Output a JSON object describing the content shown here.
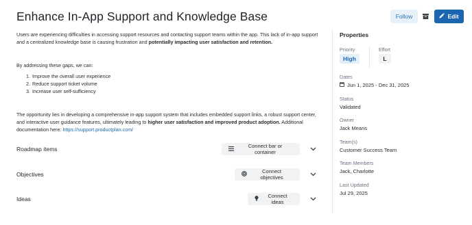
{
  "header": {
    "title": "Enhance In-App Support and Knowledge Base",
    "follow_label": "Follow",
    "edit_label": "Edit"
  },
  "description": {
    "p1_start": "Users are experiencing difficulties in accessing support resources and contacting support teams within the app. This lack of in-app support and a centralized knowledge base is causing frustration and ",
    "p1_bold": "potentially impacting user satisfaction and retention.",
    "p2": "By addressing these gaps, we can:",
    "goals": [
      {
        "num": "1.",
        "text": "Improve the overall user experience"
      },
      {
        "num": "2.",
        "text": "Reduce support ticket volume"
      },
      {
        "num": "3.",
        "text": "Increase user self-sufficiency"
      }
    ],
    "p3_start": "The opportunity lies in developing a comprehensive in-app support system that includes embedded support links, a robust support center, and interactive user guidance features, ultimately leading to ",
    "p3_bold": "higher user satisfaction and improved product adoption.",
    "p3_doc": " Additional documentation here: ",
    "link": "https://support.productplan.com/"
  },
  "sections": {
    "roadmap": {
      "title": "Roadmap items",
      "button": "Connect bar or container"
    },
    "objectives": {
      "title": "Objectives",
      "button": "Connect objectives"
    },
    "ideas": {
      "title": "Ideas",
      "button": "Connect ideas"
    }
  },
  "properties": {
    "title": "Properties",
    "priority_label": "Priority",
    "priority_value": "High",
    "effort_label": "Effort",
    "effort_value": "L",
    "dates_label": "Dates",
    "dates_value": "Jun 1, 2025 - Dec 31, 2025",
    "status_label": "Status",
    "status_value": "Validated",
    "owner_label": "Owner",
    "owner_value": "Jack Means",
    "teams_label": "Team(s)",
    "teams_value": "Customer Success Team",
    "members_label": "Team Members",
    "members_value": "Jack, Charlotte",
    "updated_label": "Last Updated",
    "updated_value": "Jul 29, 2025"
  },
  "colors": {
    "primary": "#1c66b1",
    "follow_bg": "#e7f1fa",
    "neutral_btn": "#f1f2f3"
  }
}
